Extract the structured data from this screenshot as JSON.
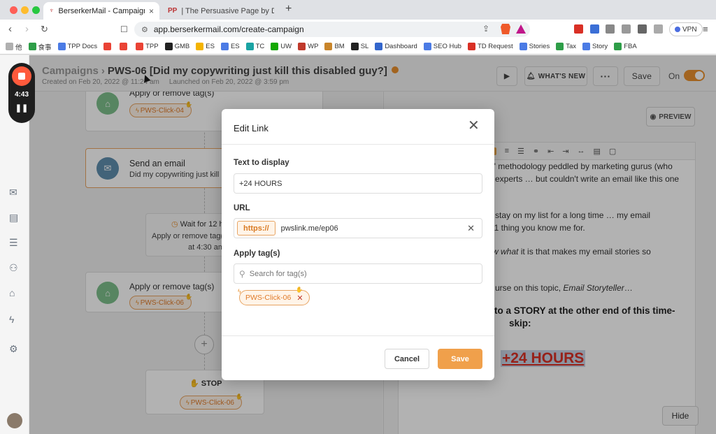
{
  "browser": {
    "tabs": [
      {
        "label": "BerserkerMail - Campaign",
        "active": true
      },
      {
        "label": "| The Persuasive Page by Daniel T",
        "active": false
      }
    ],
    "address": "app.berserkermail.com/create-campaign",
    "vpn_label": "VPN",
    "bookmarks": [
      {
        "label": "他",
        "color": "#b0b0b0"
      },
      {
        "label": "食事",
        "color": "#2e9e48"
      },
      {
        "label": "TPP Docs",
        "color": "#4b7be5"
      },
      {
        "label": "",
        "color": "#ea4335"
      },
      {
        "label": "",
        "color": "#ea4335"
      },
      {
        "label": "TPP",
        "color": "#ea4335"
      },
      {
        "label": "GMB",
        "color": "#222222"
      },
      {
        "label": "ES",
        "color": "#f4b400"
      },
      {
        "label": "ES",
        "color": "#4b7be5"
      },
      {
        "label": "TC",
        "color": "#1aa3a3"
      },
      {
        "label": "UW",
        "color": "#14a800"
      },
      {
        "label": "WP",
        "color": "#c0392b"
      },
      {
        "label": "BM",
        "color": "#c9852a"
      },
      {
        "label": "SL",
        "color": "#222222"
      },
      {
        "label": "Dashboard",
        "color": "#3366cc"
      },
      {
        "label": "SEO Hub",
        "color": "#4b7be5"
      },
      {
        "label": "TD Request",
        "color": "#d93025"
      },
      {
        "label": "Stories",
        "color": "#4b7be5"
      },
      {
        "label": "Tax",
        "color": "#2e9e48"
      },
      {
        "label": "Story",
        "color": "#4b7be5"
      },
      {
        "label": "FBA",
        "color": "#2e9e48"
      }
    ]
  },
  "recorder": {
    "time": "4:43"
  },
  "header": {
    "crumb_root": "Campaigns",
    "campaign_name": "PWS-06 [Did my copywriting just kill this disabled guy?]",
    "created": "Created on Feb 20, 2022 @ 11:24 am",
    "launched": "Launched on Feb 20, 2022 @ 3:59 pm",
    "whats_new": "WHAT'S NEW",
    "more": "···",
    "save": "Save",
    "on_label": "On"
  },
  "flow": {
    "apply_title": "Apply or remove tag(s)",
    "tag_top": "PWS-Click-04",
    "send_title": "Send an email",
    "send_sub": "Did my copywriting just kill",
    "wait_title": "Wait for 12 h",
    "wait_sub1": "Apply or remove tag(s",
    "wait_sub2": "at 4:30 am",
    "apply2_title": "Apply or remove tag(s)",
    "tag_mid": "PWS-Click-06",
    "stop_title": "STOP",
    "tag_stop": "PWS-Click-06"
  },
  "editor": {
    "preview": "PREVIEW",
    "hide": "Hide",
    "lines": [
      "g\" methodology peddled by marketing gurus (who",
      "experts … but couldn't write an email like this one",
      "stay on my list for a long time … my email",
      "#1 thing you know me for."
    ],
    "line5_italic": "w what",
    "line5_rest": " it is that makes my email stories so",
    "line6_pre": "urse on this topic, ",
    "line6_italic": "Email Storyteller",
    "line6_post": "…",
    "bold1": "to a STORY at the other end of this time-",
    "bold2": "skip:",
    "big_link": "+24 HOURS"
  },
  "modal": {
    "title": "Edit Link",
    "text_label": "Text to display",
    "text_value": "+24 HOURS",
    "url_label": "URL",
    "url_prefix": "https://",
    "url_value": "pwslink.me/ep06",
    "tags_label": "Apply tag(s)",
    "tags_placeholder": "Search for tag(s)",
    "tag": "PWS-Click-06",
    "cancel": "Cancel",
    "save": "Save"
  },
  "colors": {
    "accent": "#f0a04b",
    "record": "#ff5a3c",
    "link_red": "#d93025"
  }
}
